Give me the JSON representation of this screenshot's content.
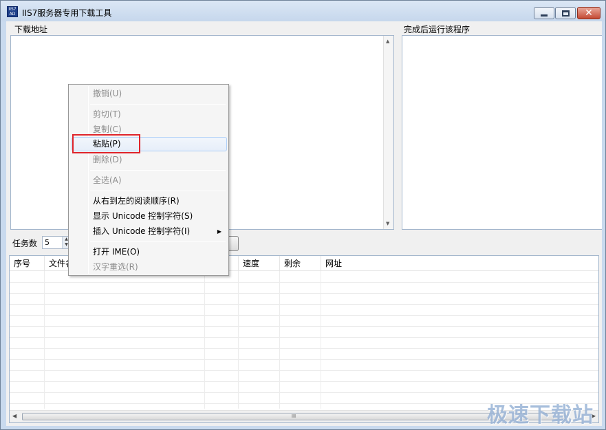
{
  "window": {
    "title": "IIS7服务器专用下载工具",
    "icon_text": "IIS7\nAD"
  },
  "labels": {
    "download_url": "下载地址",
    "run_after": "完成后运行该程序",
    "task_count": "任务数",
    "task_count_value": "5"
  },
  "table": {
    "columns": [
      "序号",
      "文件名",
      "速度",
      "剩余",
      "网址"
    ]
  },
  "context_menu": {
    "items": [
      {
        "label": "撤销(U)",
        "enabled": false
      },
      {
        "label": "剪切(T)",
        "enabled": false
      },
      {
        "label": "复制(C)",
        "enabled": false
      },
      {
        "label": "粘贴(P)",
        "enabled": true,
        "hovered": true
      },
      {
        "label": "删除(D)",
        "enabled": false
      },
      {
        "label": "全选(A)",
        "enabled": false
      },
      {
        "label": "从右到左的阅读顺序(R)",
        "enabled": true
      },
      {
        "label": "显示 Unicode 控制字符(S)",
        "enabled": true
      },
      {
        "label": "插入 Unicode 控制字符(I)",
        "enabled": true,
        "submenu": true
      },
      {
        "label": "打开 IME(O)",
        "enabled": true
      },
      {
        "label": "汉字重选(R)",
        "enabled": false
      }
    ]
  },
  "icons": {
    "submenu_arrow": "▶",
    "scroll_up": "▲",
    "scroll_down": "▼",
    "scroll_left": "◀",
    "scroll_right": "▶",
    "close": "✕"
  },
  "watermark": "极速下载站",
  "colors": {
    "highlight_red": "#e0242a",
    "titlebar": "#c6d7ec"
  }
}
